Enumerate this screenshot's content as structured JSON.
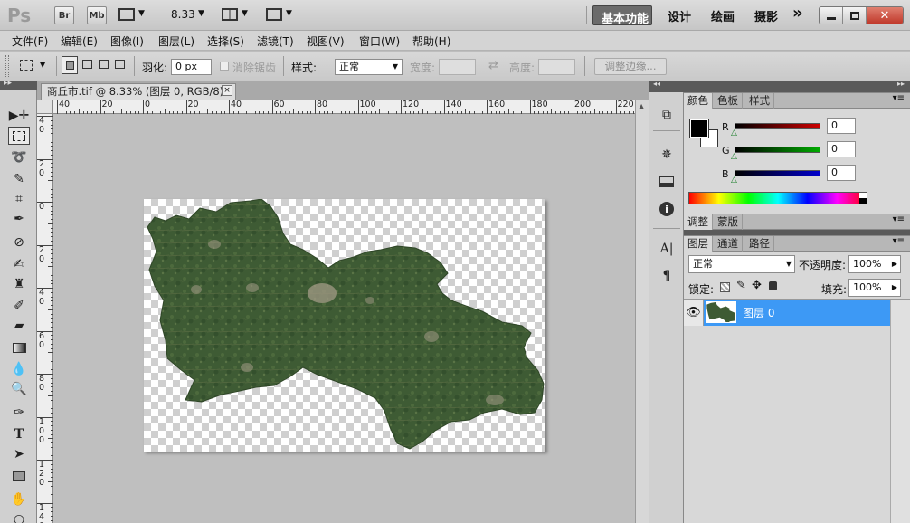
{
  "titlebar": {
    "app_logo": "Ps",
    "bridge": "Br",
    "minibridge": "Mb",
    "zoom": "8.33",
    "workspaces": [
      "基本功能",
      "设计",
      "绘画",
      "摄影"
    ],
    "more": "»",
    "window_buttons": [
      "minimize",
      "restore",
      "close"
    ]
  },
  "menu": [
    "文件(F)",
    "编辑(E)",
    "图像(I)",
    "图层(L)",
    "选择(S)",
    "滤镜(T)",
    "视图(V)",
    "窗口(W)",
    "帮助(H)"
  ],
  "options": {
    "feather_label": "羽化:",
    "feather_value": "0 px",
    "antialias_label": "消除锯齿",
    "style_label": "样式:",
    "style_value": "正常",
    "width_label": "宽度:",
    "height_label": "高度:",
    "refine_edge": "调整边缘..."
  },
  "document": {
    "tab_title": "商丘市.tif @ 8.33% (图层 0, RGB/8)",
    "close": "×"
  },
  "ruler": {
    "top_labels": [
      "40",
      "20",
      "0",
      "20",
      "40",
      "60",
      "80",
      "100",
      "120",
      "140",
      "160",
      "180",
      "200",
      "220"
    ],
    "left_labels": [
      "4\n0",
      "2\n0",
      "0",
      "2\n0",
      "4\n0",
      "6\n0",
      "8\n0",
      "1\n0\n0",
      "1\n2\n0",
      "1\n4\n0"
    ]
  },
  "panels": {
    "color_tabs": [
      "颜色",
      "色板",
      "样式"
    ],
    "channels": [
      {
        "label": "R",
        "value": "0",
        "color": "#cc0000"
      },
      {
        "label": "G",
        "value": "0",
        "color": "#00aa00"
      },
      {
        "label": "B",
        "value": "0",
        "color": "#0000cc"
      }
    ],
    "adjust_tabs": [
      "调整",
      "蒙版"
    ],
    "layers_tabs": [
      "图层",
      "通道",
      "路径"
    ],
    "blend_mode": "正常",
    "opacity_label": "不透明度:",
    "opacity_value": "100%",
    "lock_label": "锁定:",
    "fill_label": "填充:",
    "fill_value": "100%",
    "layer_name": "图层 0"
  },
  "colors": {
    "selection": "#3d99f5",
    "active_workspace": "#6b6b6b"
  }
}
